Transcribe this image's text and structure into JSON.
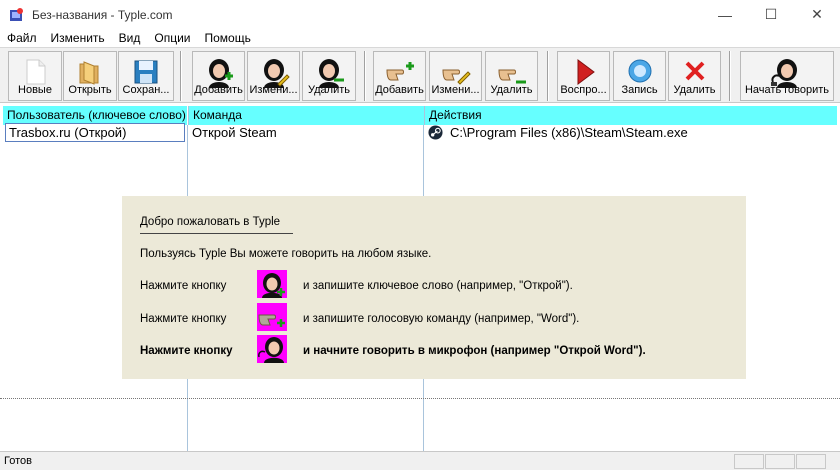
{
  "window": {
    "title": "Без-названия - Typle.com",
    "controls": {
      "minimize": "—",
      "maximize": "☐",
      "close": "✕"
    }
  },
  "menu": [
    "Файл",
    "Изменить",
    "Вид",
    "Опции",
    "Помощь"
  ],
  "toolbar": {
    "new": "Новые",
    "open": "Открыть",
    "save": "Сохран...",
    "add_user": "Добавить",
    "edit_user": "Измени...",
    "delete_user": "Удалить",
    "add_command": "Добавить",
    "edit_command": "Измени...",
    "delete_command": "Удалить",
    "play": "Воспро...",
    "record": "Запись",
    "delete_action": "Удалить",
    "start_speaking": "Начать говорить"
  },
  "list": {
    "columns": [
      "Пользователь (ключевое слово)",
      "Команда",
      "Действия"
    ],
    "rows": [
      {
        "user": "Trasbox.ru (Открой)",
        "command": "Открой Steam",
        "action": "C:\\Program Files (x86)\\Steam\\Steam.exe",
        "action_icon": "steam-icon"
      }
    ]
  },
  "welcome": {
    "title": "Добро пожаловать в Typle",
    "intro": "Пользуясь Typle Вы можете говорить на любом языке.",
    "steps": [
      {
        "label": "Нажмите кнопку",
        "icon": "user-add-icon",
        "text": "и запишите ключевое слово (например, \"Открой\")."
      },
      {
        "label": "Нажмите кнопку",
        "icon": "command-add-icon",
        "text": "и запишите голосовую команду (например, \"Word\")."
      },
      {
        "label": "Нажмите кнопку",
        "icon": "start-speaking-icon",
        "text": "и начните говорить в микрофон (например \"Открой Word\")."
      }
    ]
  },
  "status": {
    "text": "Готов"
  },
  "colors": {
    "header_bg": "#66ffff",
    "welcome_bg": "#ece9d8",
    "toolbar_bg": "#f0f0f0",
    "icon_bg": "#ff00ff"
  }
}
